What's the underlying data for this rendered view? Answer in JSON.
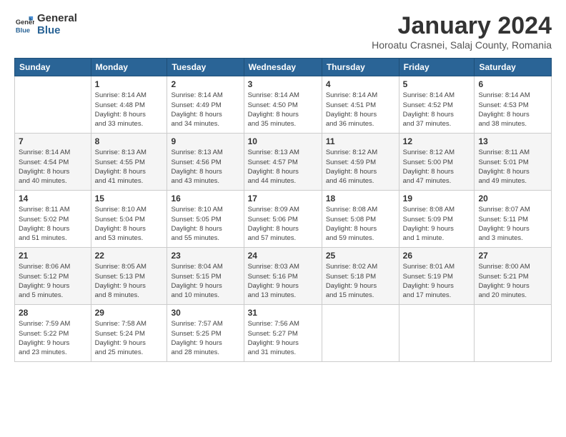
{
  "logo": {
    "general": "General",
    "blue": "Blue"
  },
  "title": "January 2024",
  "subtitle": "Horoatu Crasnei, Salaj County, Romania",
  "days_of_week": [
    "Sunday",
    "Monday",
    "Tuesday",
    "Wednesday",
    "Thursday",
    "Friday",
    "Saturday"
  ],
  "weeks": [
    [
      {
        "day": "",
        "info": ""
      },
      {
        "day": "1",
        "info": "Sunrise: 8:14 AM\nSunset: 4:48 PM\nDaylight: 8 hours\nand 33 minutes."
      },
      {
        "day": "2",
        "info": "Sunrise: 8:14 AM\nSunset: 4:49 PM\nDaylight: 8 hours\nand 34 minutes."
      },
      {
        "day": "3",
        "info": "Sunrise: 8:14 AM\nSunset: 4:50 PM\nDaylight: 8 hours\nand 35 minutes."
      },
      {
        "day": "4",
        "info": "Sunrise: 8:14 AM\nSunset: 4:51 PM\nDaylight: 8 hours\nand 36 minutes."
      },
      {
        "day": "5",
        "info": "Sunrise: 8:14 AM\nSunset: 4:52 PM\nDaylight: 8 hours\nand 37 minutes."
      },
      {
        "day": "6",
        "info": "Sunrise: 8:14 AM\nSunset: 4:53 PM\nDaylight: 8 hours\nand 38 minutes."
      }
    ],
    [
      {
        "day": "7",
        "info": "Sunrise: 8:14 AM\nSunset: 4:54 PM\nDaylight: 8 hours\nand 40 minutes."
      },
      {
        "day": "8",
        "info": "Sunrise: 8:13 AM\nSunset: 4:55 PM\nDaylight: 8 hours\nand 41 minutes."
      },
      {
        "day": "9",
        "info": "Sunrise: 8:13 AM\nSunset: 4:56 PM\nDaylight: 8 hours\nand 43 minutes."
      },
      {
        "day": "10",
        "info": "Sunrise: 8:13 AM\nSunset: 4:57 PM\nDaylight: 8 hours\nand 44 minutes."
      },
      {
        "day": "11",
        "info": "Sunrise: 8:12 AM\nSunset: 4:59 PM\nDaylight: 8 hours\nand 46 minutes."
      },
      {
        "day": "12",
        "info": "Sunrise: 8:12 AM\nSunset: 5:00 PM\nDaylight: 8 hours\nand 47 minutes."
      },
      {
        "day": "13",
        "info": "Sunrise: 8:11 AM\nSunset: 5:01 PM\nDaylight: 8 hours\nand 49 minutes."
      }
    ],
    [
      {
        "day": "14",
        "info": "Sunrise: 8:11 AM\nSunset: 5:02 PM\nDaylight: 8 hours\nand 51 minutes."
      },
      {
        "day": "15",
        "info": "Sunrise: 8:10 AM\nSunset: 5:04 PM\nDaylight: 8 hours\nand 53 minutes."
      },
      {
        "day": "16",
        "info": "Sunrise: 8:10 AM\nSunset: 5:05 PM\nDaylight: 8 hours\nand 55 minutes."
      },
      {
        "day": "17",
        "info": "Sunrise: 8:09 AM\nSunset: 5:06 PM\nDaylight: 8 hours\nand 57 minutes."
      },
      {
        "day": "18",
        "info": "Sunrise: 8:08 AM\nSunset: 5:08 PM\nDaylight: 8 hours\nand 59 minutes."
      },
      {
        "day": "19",
        "info": "Sunrise: 8:08 AM\nSunset: 5:09 PM\nDaylight: 9 hours\nand 1 minute."
      },
      {
        "day": "20",
        "info": "Sunrise: 8:07 AM\nSunset: 5:11 PM\nDaylight: 9 hours\nand 3 minutes."
      }
    ],
    [
      {
        "day": "21",
        "info": "Sunrise: 8:06 AM\nSunset: 5:12 PM\nDaylight: 9 hours\nand 5 minutes."
      },
      {
        "day": "22",
        "info": "Sunrise: 8:05 AM\nSunset: 5:13 PM\nDaylight: 9 hours\nand 8 minutes."
      },
      {
        "day": "23",
        "info": "Sunrise: 8:04 AM\nSunset: 5:15 PM\nDaylight: 9 hours\nand 10 minutes."
      },
      {
        "day": "24",
        "info": "Sunrise: 8:03 AM\nSunset: 5:16 PM\nDaylight: 9 hours\nand 13 minutes."
      },
      {
        "day": "25",
        "info": "Sunrise: 8:02 AM\nSunset: 5:18 PM\nDaylight: 9 hours\nand 15 minutes."
      },
      {
        "day": "26",
        "info": "Sunrise: 8:01 AM\nSunset: 5:19 PM\nDaylight: 9 hours\nand 17 minutes."
      },
      {
        "day": "27",
        "info": "Sunrise: 8:00 AM\nSunset: 5:21 PM\nDaylight: 9 hours\nand 20 minutes."
      }
    ],
    [
      {
        "day": "28",
        "info": "Sunrise: 7:59 AM\nSunset: 5:22 PM\nDaylight: 9 hours\nand 23 minutes."
      },
      {
        "day": "29",
        "info": "Sunrise: 7:58 AM\nSunset: 5:24 PM\nDaylight: 9 hours\nand 25 minutes."
      },
      {
        "day": "30",
        "info": "Sunrise: 7:57 AM\nSunset: 5:25 PM\nDaylight: 9 hours\nand 28 minutes."
      },
      {
        "day": "31",
        "info": "Sunrise: 7:56 AM\nSunset: 5:27 PM\nDaylight: 9 hours\nand 31 minutes."
      },
      {
        "day": "",
        "info": ""
      },
      {
        "day": "",
        "info": ""
      },
      {
        "day": "",
        "info": ""
      }
    ]
  ]
}
